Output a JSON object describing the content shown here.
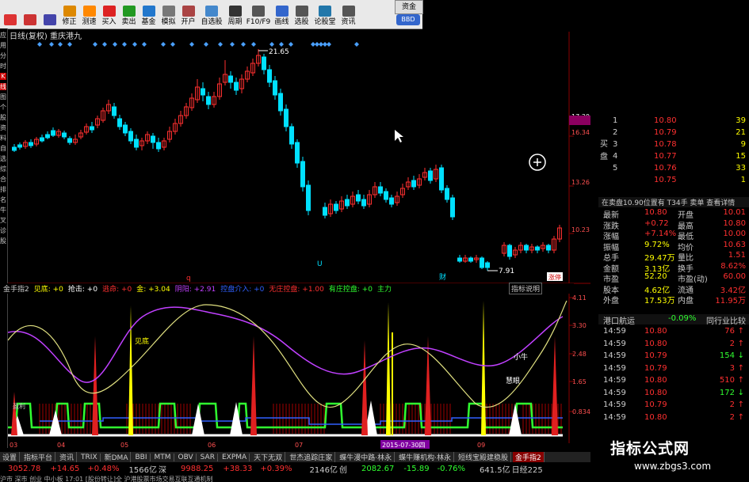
{
  "toolbar": {
    "items": [
      {
        "label": "",
        "icon": "back-icon",
        "color": "#d33"
      },
      {
        "label": "",
        "icon": "home-icon",
        "color": "#c33"
      },
      {
        "label": "",
        "icon": "refresh-icon",
        "color": "#44a"
      },
      {
        "label": "修正",
        "icon": "edit-icon",
        "color": "#d80"
      },
      {
        "label": "测速",
        "icon": "clock-icon",
        "color": "#f80"
      },
      {
        "label": "买入",
        "icon": "buy-icon",
        "color": "#d22"
      },
      {
        "label": "卖出",
        "icon": "sell-icon",
        "color": "#292"
      },
      {
        "label": "基金",
        "icon": "fund-icon",
        "color": "#27c"
      },
      {
        "label": "模拟",
        "icon": "sim-icon",
        "color": "#777"
      },
      {
        "label": "开户",
        "icon": "account-icon",
        "color": "#a44"
      },
      {
        "label": "自选股",
        "icon": "watchlist-icon",
        "color": "#48c"
      },
      {
        "label": "周期",
        "icon": "period-icon",
        "color": "#333"
      },
      {
        "label": "F10/F9",
        "icon": "f10-icon",
        "color": "#555"
      },
      {
        "label": "画线",
        "icon": "pen-icon",
        "color": "#36c"
      },
      {
        "label": "选股",
        "icon": "select-icon",
        "color": "#555"
      },
      {
        "label": "论股堂",
        "icon": "forum-icon",
        "color": "#27a"
      },
      {
        "label": "资讯",
        "icon": "news-icon",
        "color": "#555"
      }
    ],
    "right_top": "资金",
    "right_bottom": "BBD"
  },
  "left_strip": [
    "应",
    "用",
    "分",
    "时",
    "K",
    "线",
    "图",
    "个",
    "股",
    "资",
    "料",
    "自",
    "选",
    "综",
    "合",
    "排",
    "名",
    "牛",
    "叉",
    "诊",
    "股"
  ],
  "chart": {
    "title": "日线(复权)  重庆港九",
    "high_label": "21.65",
    "low_label": "7.91",
    "price_ticks": [
      "17.30",
      "16.34",
      "13.26",
      "10.23"
    ],
    "marker_q": "q",
    "marker_u": "U",
    "marker_cai": "财",
    "marker_shang": "涨停"
  },
  "indicator": {
    "name": "金手指2",
    "items": [
      {
        "text": "见底: +0",
        "color": "#ffff00"
      },
      {
        "text": "抢击: +0",
        "color": "#ffffff"
      },
      {
        "text": "逃命: +0",
        "color": "#ff3030"
      },
      {
        "text": "金: +3.04",
        "color": "#ffff00"
      },
      {
        "text": "阴阳: +2.91",
        "color": "#c040ff"
      },
      {
        "text": "控盘介入: +0",
        "color": "#3060ff"
      },
      {
        "text": "无庄控盘: +1.00",
        "color": "#ff3030"
      },
      {
        "text": "有庄控盘: +0",
        "color": "#30ff30"
      },
      {
        "text": "主力",
        "color": "#30ff30"
      }
    ],
    "help": "指标说明",
    "ticks": [
      "4.11",
      "3.30",
      "2.48",
      "1.65",
      "0.834"
    ],
    "label_jiandi": "见底",
    "label_xiaoniu": "小牛",
    "label_huiyan": "慧眼",
    "label_ying": "盈利",
    "date_label": "2015-07-30四",
    "x_ticks": [
      "03",
      "04",
      "05",
      "06",
      "07",
      "08",
      "09"
    ]
  },
  "right_panel": {
    "top_price": "17.30",
    "buy_label": "买盘",
    "bids": [
      {
        "n": "1",
        "p": "10.80",
        "v": "39"
      },
      {
        "n": "2",
        "p": "10.79",
        "v": "21"
      },
      {
        "n": "3",
        "p": "10.78",
        "v": "9"
      },
      {
        "n": "4",
        "p": "10.77",
        "v": "15"
      },
      {
        "n": "5",
        "p": "10.76",
        "v": "33"
      },
      {
        "n": "",
        "p": "10.75",
        "v": "1"
      }
    ],
    "sell_line": "在卖盘10.90位置有  T34手  卖单  查看详情",
    "quote": [
      {
        "k1": "最新",
        "v1": "10.80",
        "k2": "开盘",
        "v2": "10.01"
      },
      {
        "k1": "涨跌",
        "v1": "+0.72",
        "k2": "最高",
        "v2": "10.80"
      },
      {
        "k1": "涨幅",
        "v1": "+7.14%",
        "k2": "最低",
        "v2": "10.00"
      },
      {
        "k1": "振幅",
        "v1": "9.72%",
        "k2": "均价",
        "v2": "10.63"
      },
      {
        "k1": "总手",
        "v1": "29.47万",
        "k2": "量比",
        "v2": "1.51"
      },
      {
        "k1": "金额",
        "v1": "3.13亿",
        "k2": "换手",
        "v2": "8.62%"
      },
      {
        "k1": "市盈",
        "v1": "52.20",
        "k2": "市盈(动)",
        "v2": "60.00"
      },
      {
        "k1": "股本",
        "v1": "4.62亿",
        "k2": "流通",
        "v2": "3.42亿"
      },
      {
        "k1": "外盘",
        "v1": "17.53万",
        "k2": "内盘",
        "v2": "11.95万"
      }
    ],
    "sector_name": "港口航运",
    "sector_chg": "-0.09%",
    "sector_btn": "同行业比较",
    "ticks": [
      {
        "t": "14:59",
        "p": "10.80",
        "v": "76"
      },
      {
        "t": "14:59",
        "p": "10.80",
        "v": "2"
      },
      {
        "t": "14:59",
        "p": "10.79",
        "v": "154"
      },
      {
        "t": "14:59",
        "p": "10.79",
        "v": "3"
      },
      {
        "t": "14:59",
        "p": "10.80",
        "v": "510"
      },
      {
        "t": "14:59",
        "p": "10.80",
        "v": "172"
      },
      {
        "t": "14:59",
        "p": "10.79",
        "v": "2"
      },
      {
        "t": "14:59",
        "p": "10.80",
        "v": "2"
      }
    ]
  },
  "tabs": [
    "设置",
    "指标平台",
    "资讯",
    "TRIX",
    "新DMA",
    "BBI",
    "MTM",
    "OBV",
    "SAR",
    "EXPMA",
    "天下无双",
    "世杰追踪庄家",
    "蝶牛漫中路·林永",
    "蝶牛赚机构·林永",
    "短线宝殿建稳股",
    "金手指2"
  ],
  "status": {
    "sh_val": "3052.78",
    "sh_chg": "+14.65",
    "sh_pct": "+0.48%",
    "sh_amt": "1566亿",
    "sh_name": "深",
    "sz_val": "9988.25",
    "sz_chg": "+38.33",
    "sz_pct": "+0.39%",
    "sz_amt": "2146亿",
    "cy_name": "创",
    "cy_val": "2082.67",
    "cy_chg": "-15.89",
    "cy_pct": "-0.76%",
    "cy_amt": "641.5亿",
    "rj": "日经225"
  },
  "status2": "沪市 深市 创业 中小板   17:01 [股份转让]全 沪港股票市场交易互联互通机制",
  "watermark": {
    "line1": "指标公式网",
    "line2": "www.zbgs3.com"
  },
  "colors": {
    "up": "#ff3030",
    "down": "#00e0ff",
    "bg": "#000000",
    "grid": "#8b0000"
  }
}
